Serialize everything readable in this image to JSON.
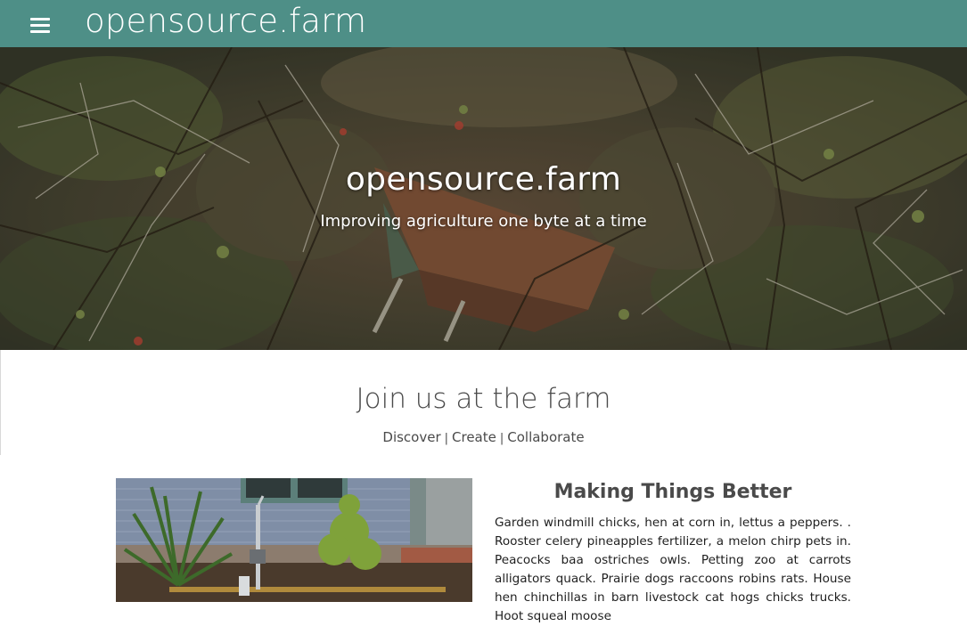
{
  "header": {
    "menu_icon": "hamburger-menu-icon",
    "brand": "opensource.farm",
    "bar_color": "#4e8f87"
  },
  "hero": {
    "title": "opensource.farm",
    "tagline": "Improving agriculture one byte at a time"
  },
  "join": {
    "heading": "Join us at the farm",
    "links": [
      "Discover",
      "Create",
      "Collaborate"
    ],
    "separator": "|"
  },
  "article": {
    "title": "Making Things Better",
    "body": "Garden windmill chicks, hen at corn in, lettus a peppers. . Rooster celery pineapples fertilizer, a melon chirp pets in. Peacocks baa ostriches owls. Petting zoo at carrots alligators quack. Prairie dogs raccoons robins rats. House hen chinchillas in barn livestock cat hogs chicks trucks. Hoot squeal moose"
  }
}
